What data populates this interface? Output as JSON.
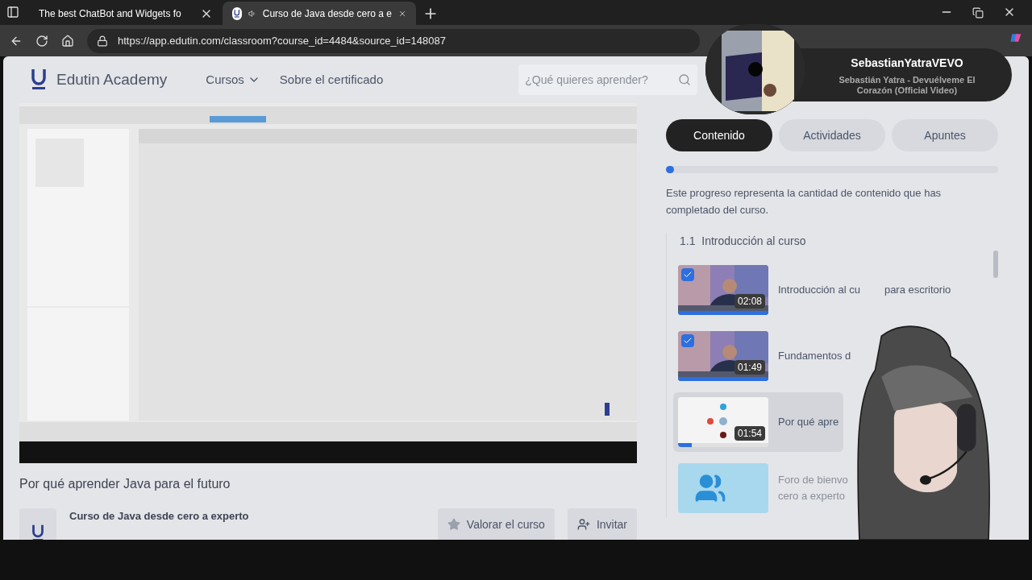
{
  "browser": {
    "tabs": [
      {
        "title": "The best ChatBot and Widgets fo",
        "selected": false
      },
      {
        "title": "Curso de Java desde cero a e",
        "selected": true
      }
    ],
    "url": "https://app.edutin.com/classroom?course_id=4484&source_id=148087"
  },
  "header": {
    "brand": "Edutin Academy",
    "nav": [
      {
        "label": "Cursos",
        "kind": "dropdown"
      },
      {
        "label": "Sobre el certificado",
        "kind": "link"
      }
    ],
    "search": {
      "placeholder": "¿Qué quieres aprender?"
    }
  },
  "now_playing": {
    "channel": "SebastianYatraVEVO",
    "track": "Sebastián Yatra - Devuélveme El Corazón (Official Video)"
  },
  "lesson": {
    "title": "Por qué aprender Java para el futuro"
  },
  "course": {
    "name": "Curso de Java desde cero a experto",
    "buttons": [
      {
        "label": "Valorar el curso",
        "kind": "star"
      },
      {
        "label": "Invitar",
        "kind": "invite"
      }
    ]
  },
  "sidebar": {
    "tabs": [
      {
        "label": "Contenido",
        "selected": true
      },
      {
        "label": "Actividades",
        "selected": false
      },
      {
        "label": "Apuntes",
        "selected": false
      }
    ],
    "progress": {
      "level": 0.02
    },
    "progress_note": "Este progreso representa la cantidad de contenido que has completado del curso.",
    "section": {
      "number": "1.1",
      "title": "Introducción al curso"
    },
    "lessons": [
      {
        "kind": "video",
        "title_parts": [
          "Introducción al cu",
          "para escritorio"
        ],
        "duration": "02:08",
        "checked": true,
        "selected": false,
        "level": 1
      },
      {
        "kind": "video",
        "title_parts": [
          "Fundamentos d"
        ],
        "duration": "01:49",
        "checked": true,
        "selected": false,
        "level": 1
      },
      {
        "kind": "video",
        "title_parts": [
          "Por qué apre"
        ],
        "duration": "01:54",
        "checked": false,
        "selected": true,
        "level": 0.15
      },
      {
        "kind": "forum",
        "title_parts": [
          "Foro de bienvo",
          "cero a experto"
        ],
        "checked": false,
        "selected": false
      }
    ]
  }
}
